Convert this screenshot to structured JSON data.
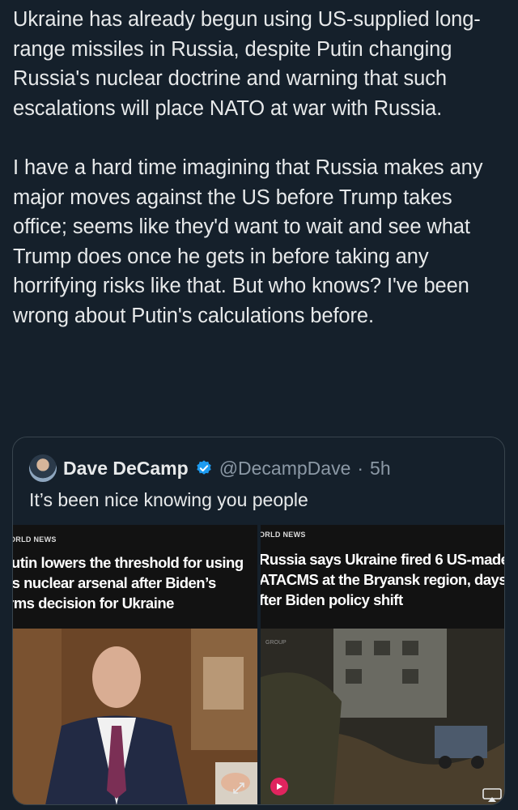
{
  "post": {
    "paragraphs": [
      "Ukraine has already begun using US-supplied long-range missiles in Russia, despite Putin changing Russia's nuclear doctrine and warning that such escalations will place NATO at war with Russia.",
      "I have a hard time imagining that Russia makes any major moves against the US before Trump takes office; seems like they'd want to wait and see what Trump does once he gets in before taking any horrifying risks like that. But who knows? I've been wrong about Putin's calculations before."
    ]
  },
  "quote": {
    "author_name": "Dave DeCamp",
    "handle": "@DecampDave",
    "separator": "·",
    "time": "5h",
    "text": "It’s been nice knowing you people"
  },
  "media": {
    "left": {
      "kicker": "ORLD NEWS",
      "headline": "'utin lowers the threshold for using\nis nuclear arsenal after Biden’s\nrms decision for Ukraine"
    },
    "right": {
      "kicker": "ORLD NEWS",
      "headline": "Russia says Ukraine fired 6 US-made\nATACMS at the Bryansk region, days\nfter Biden policy shift",
      "brand": "GROUP"
    }
  },
  "colors": {
    "background": "#15202b",
    "text": "#e7e9ea",
    "muted": "#8b98a5",
    "verified": "#1d9bf0",
    "play": "#e0245e"
  },
  "icons": {
    "verified": "verified-badge-icon",
    "expand": "expand-icon",
    "play": "play-icon",
    "airplay": "airplay-icon"
  }
}
